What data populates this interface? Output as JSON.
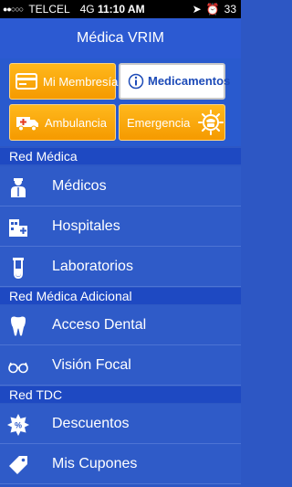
{
  "statusbar": {
    "carrier": "TELCEL",
    "network": "4G",
    "time": "11:10 AM",
    "battery_partial": "33"
  },
  "header": {
    "title": "Médica VRIM"
  },
  "tiles": [
    {
      "label": "Mi Membresía",
      "icon": "membership-card-icon"
    },
    {
      "label": "Medicamentos",
      "icon": "info-icon"
    },
    {
      "label": "Ambulancia",
      "icon": "ambulance-icon"
    },
    {
      "label": "Emergencia",
      "icon": "telephone-icon"
    }
  ],
  "sections": [
    {
      "title": "Red Médica",
      "items": [
        {
          "label": "Médicos",
          "icon": "doctor-icon"
        },
        {
          "label": "Hospitales",
          "icon": "hospital-icon"
        },
        {
          "label": "Laboratorios",
          "icon": "test-tube-icon"
        }
      ]
    },
    {
      "title": "Red Médica Adicional",
      "items": [
        {
          "label": "Acceso Dental",
          "icon": "tooth-icon"
        },
        {
          "label": "Visión Focal",
          "icon": "glasses-icon"
        }
      ]
    },
    {
      "title": "Red TDC",
      "items": [
        {
          "label": "Descuentos",
          "icon": "discount-burst-icon"
        },
        {
          "label": "Mis Cupones",
          "icon": "coupon-tag-icon"
        }
      ]
    }
  ],
  "colors": {
    "navbar": "#2c5ad2",
    "tile_orange": "#ffb81c",
    "section_header": "#1e49c2",
    "row_bg": "#2f5bc8"
  }
}
